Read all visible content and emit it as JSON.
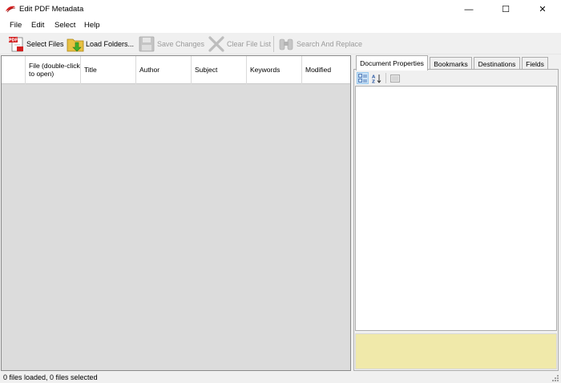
{
  "window": {
    "title": "Edit PDF Metadata",
    "minimize_glyph": "—",
    "maximize_glyph": "☐",
    "close_glyph": "✕"
  },
  "menu": {
    "file": "File",
    "edit": "Edit",
    "select": "Select",
    "help": "Help"
  },
  "toolbar": {
    "select_files": "Select Files",
    "load_folders": "Load Folders...",
    "save_changes": "Save Changes",
    "clear_file_list": "Clear File List",
    "search_and_replace": "Search And Replace",
    "pdf_icon_text": "PDF"
  },
  "grid": {
    "columns": {
      "file": "File (double-click to open)",
      "title": "Title",
      "author": "Author",
      "subject": "Subject",
      "keywords": "Keywords",
      "modified": "Modified"
    }
  },
  "tabs": {
    "document_properties": "Document Properties",
    "bookmarks": "Bookmarks",
    "destinations": "Destinations",
    "fields": "Fields"
  },
  "colors": {
    "description_background": "#f0e9aa",
    "grid_background": "#dcdcdc",
    "selected_button": "#cce4f7"
  },
  "status": {
    "text": "0 files loaded, 0 files selected"
  }
}
